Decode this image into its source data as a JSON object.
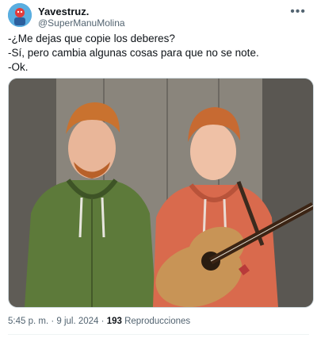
{
  "author": {
    "display_name": "Yavestruz.",
    "handle": "@SuperManuMolina"
  },
  "tweet": {
    "lines": [
      "-¿Me dejas que copie los deberes?",
      "-Sí, pero cambia algunas cosas para que no se note.",
      "-Ok."
    ]
  },
  "meta": {
    "time": "5:45 p. m.",
    "separator": " · ",
    "date": "9 jul. 2024",
    "views_count": "193",
    "views_label": " Reproducciones"
  },
  "icons": {
    "more": "more-icon",
    "avatar": "avatar-image"
  },
  "colors": {
    "text": "#0f1419",
    "secondary": "#536471",
    "border": "#cfd9de"
  }
}
